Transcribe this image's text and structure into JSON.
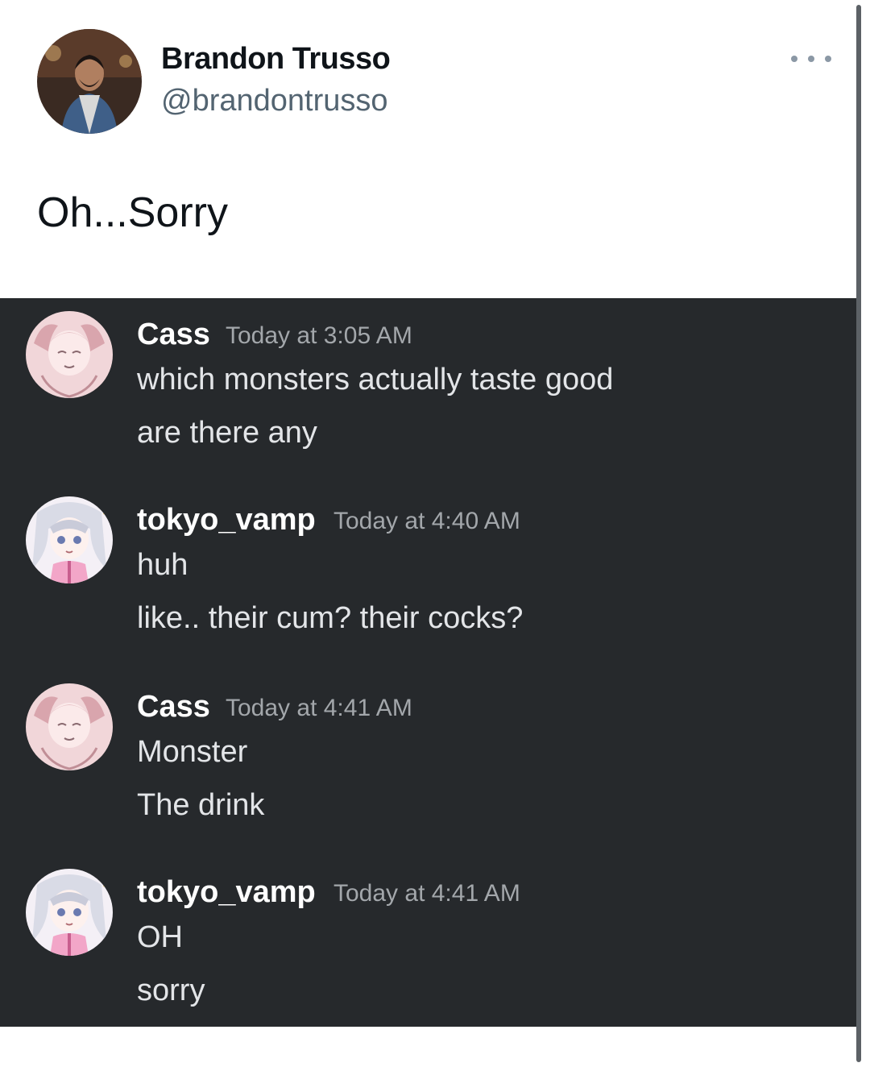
{
  "tweet": {
    "author_name": "Brandon Trusso",
    "author_handle": "@brandontrusso",
    "text": "Oh...Sorry",
    "more_icon": "more-horizontal-icon"
  },
  "discord": {
    "messages": [
      {
        "user": "Cass",
        "time": "Today at 3:05 AM",
        "lines": [
          "which monsters actually taste good",
          "are there any"
        ]
      },
      {
        "user": "tokyo_vamp",
        "time": "Today at 4:40 AM",
        "lines": [
          "huh",
          "like.. their cum? their cocks?"
        ]
      },
      {
        "user": "Cass",
        "time": "Today at 4:41 AM",
        "lines": [
          "Monster",
          "The drink"
        ]
      },
      {
        "user": "tokyo_vamp",
        "time": "Today at 4:41 AM",
        "lines": [
          "OH",
          "sorry"
        ]
      }
    ]
  },
  "colors": {
    "discord_bg": "#26292c",
    "name_text": "#0f1419",
    "handle_text": "#536471"
  }
}
